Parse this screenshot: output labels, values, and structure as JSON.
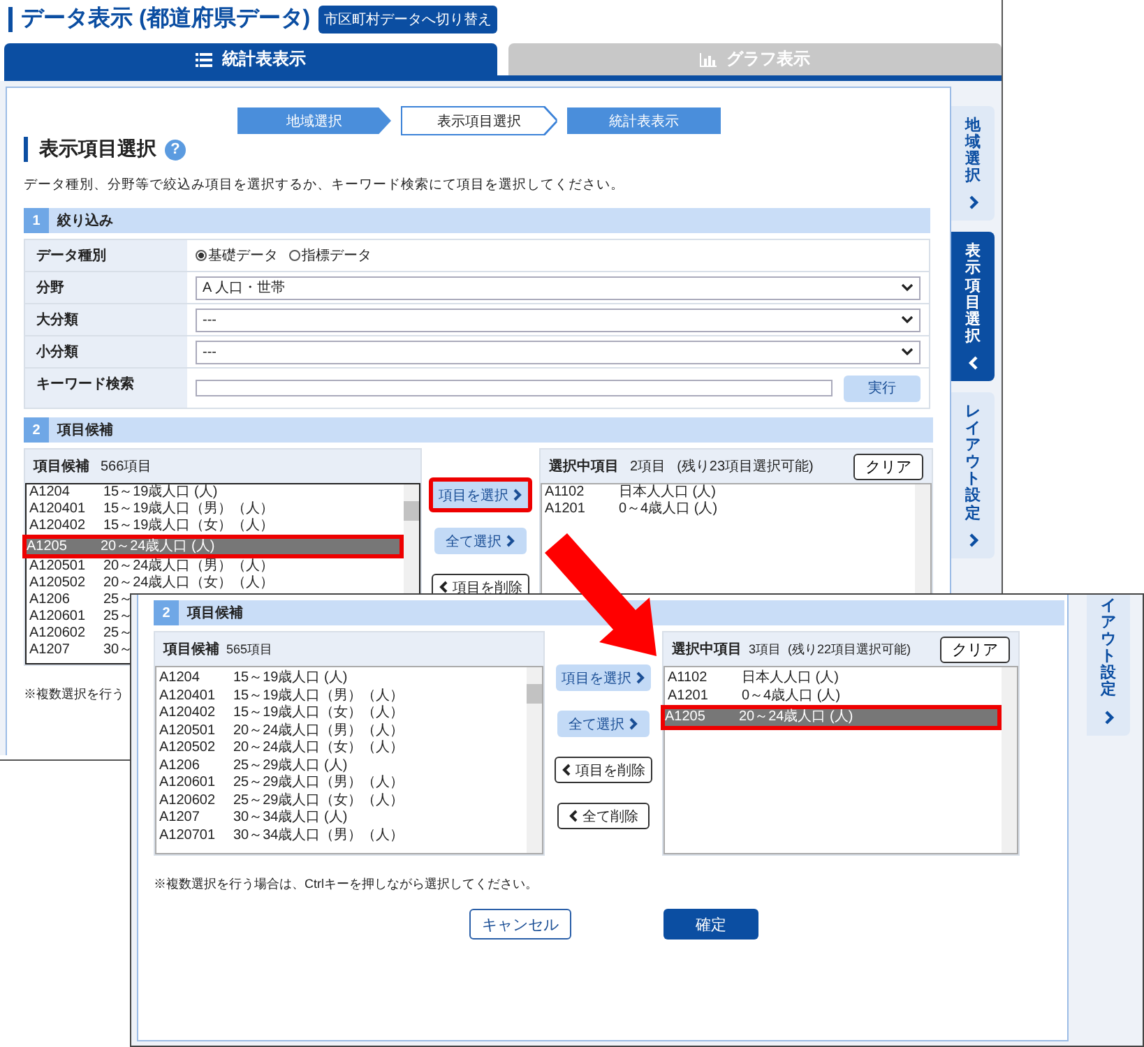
{
  "page_title": "データ表示 (都道府県データ)",
  "switch_button": "市区町村データへ切り替え",
  "view_tabs": [
    {
      "label": "統計表表示",
      "kind": "table",
      "selected": true
    },
    {
      "label": "グラフ表示",
      "kind": "graph",
      "selected": false
    }
  ],
  "steps": [
    {
      "label": "地域選択",
      "current": false
    },
    {
      "label": "表示項目選択",
      "current": true
    },
    {
      "label": "統計表表示",
      "current": false
    }
  ],
  "heading": "表示項目選択",
  "help_label": "?",
  "description": "データ種別、分野等で絞込み項目を選択するか、キーワード検索にて項目を選択してください。",
  "filter": {
    "number": "1",
    "title": "絞り込み",
    "rows": [
      {
        "kind": "radio",
        "label": "データ種別",
        "options": [
          {
            "label": "基礎データ",
            "selected": true
          },
          {
            "label": "指標データ",
            "selected": false
          }
        ]
      },
      {
        "kind": "select",
        "label": "分野",
        "value": "A 人口・世帯"
      },
      {
        "kind": "select",
        "label": "大分類",
        "value": "---"
      },
      {
        "kind": "select",
        "label": "小分類",
        "value": "---"
      },
      {
        "kind": "keyword",
        "label": "キーワード検索",
        "button": "実行"
      }
    ]
  },
  "candidates": {
    "number": "2",
    "title": "項目候補",
    "left": {
      "title": "項目候補",
      "count": "566項目",
      "rows": [
        {
          "code": "A1204",
          "name": "15～19歳人口 (人)",
          "selected": false,
          "highlighted": false
        },
        {
          "code": "A120401",
          "name": "15～19歳人口（男）（人）",
          "selected": false,
          "highlighted": false
        },
        {
          "code": "A120402",
          "name": "15～19歳人口（女）（人）",
          "selected": false,
          "highlighted": false
        },
        {
          "code": "A1205",
          "name": "20～24歳人口 (人)",
          "selected": true,
          "highlighted": true
        },
        {
          "code": "A120501",
          "name": "20～24歳人口（男）（人）",
          "selected": false,
          "highlighted": false
        },
        {
          "code": "A120502",
          "name": "20～24歳人口（女）（人）",
          "selected": false,
          "highlighted": false
        },
        {
          "code": "A1206",
          "name": "25～",
          "selected": false,
          "highlighted": false
        },
        {
          "code": "A120601",
          "name": "25～",
          "selected": false,
          "highlighted": false
        },
        {
          "code": "A120602",
          "name": "25～",
          "selected": false,
          "highlighted": false
        },
        {
          "code": "A1207",
          "name": "30～",
          "selected": false,
          "highlighted": false
        }
      ]
    },
    "actions": [
      {
        "label": "項目を選択",
        "kind": "add",
        "highlighted": true
      },
      {
        "label": "全て選択",
        "kind": "add",
        "highlighted": false
      },
      {
        "label": "項目を削除",
        "kind": "remove",
        "highlighted": false
      }
    ],
    "right": {
      "title": "選択中項目",
      "count": "2項目",
      "note": "(残り23項目選択可能)",
      "clear": "クリア",
      "rows": [
        {
          "code": "A1102",
          "name": "日本人人口 (人)",
          "selected": false,
          "highlighted": false
        },
        {
          "code": "A1201",
          "name": "0～4歳人口 (人)",
          "selected": false,
          "highlighted": false
        }
      ]
    },
    "note": "※複数選択を行う"
  },
  "side_tabs": [
    {
      "label": "地域選択",
      "selected": false
    },
    {
      "label": "表示項目選択",
      "selected": true
    },
    {
      "label": "レイアウト設定",
      "selected": false
    }
  ],
  "overlay": {
    "candidates": {
      "number": "2",
      "title": "項目候補",
      "left": {
        "title": "項目候補",
        "count": "565項目",
        "rows": [
          {
            "code": "A1204",
            "name": "15～19歳人口 (人)",
            "selected": false,
            "highlighted": false
          },
          {
            "code": "A120401",
            "name": "15～19歳人口（男）（人）",
            "selected": false,
            "highlighted": false
          },
          {
            "code": "A120402",
            "name": "15～19歳人口（女）（人）",
            "selected": false,
            "highlighted": false
          },
          {
            "code": "A120501",
            "name": "20～24歳人口（男）（人）",
            "selected": false,
            "highlighted": false
          },
          {
            "code": "A120502",
            "name": "20～24歳人口（女）（人）",
            "selected": false,
            "highlighted": false
          },
          {
            "code": "A1206",
            "name": "25～29歳人口 (人)",
            "selected": false,
            "highlighted": false
          },
          {
            "code": "A120601",
            "name": "25～29歳人口（男）（人）",
            "selected": false,
            "highlighted": false
          },
          {
            "code": "A120602",
            "name": "25～29歳人口（女）（人）",
            "selected": false,
            "highlighted": false
          },
          {
            "code": "A1207",
            "name": "30～34歳人口 (人)",
            "selected": false,
            "highlighted": false
          },
          {
            "code": "A120701",
            "name": "30～34歳人口（男）（人）",
            "selected": false,
            "highlighted": false
          }
        ]
      },
      "actions": [
        {
          "label": "項目を選択",
          "kind": "add",
          "highlighted": false
        },
        {
          "label": "全て選択",
          "kind": "add",
          "highlighted": false
        },
        {
          "label": "項目を削除",
          "kind": "remove",
          "highlighted": false
        },
        {
          "label": "全て削除",
          "kind": "remove",
          "highlighted": false
        }
      ],
      "right": {
        "title": "選択中項目",
        "count": "3項目",
        "note": "(残り22項目選択可能)",
        "clear": "クリア",
        "rows": [
          {
            "code": "A1102",
            "name": "日本人人口 (人)",
            "selected": false,
            "highlighted": false
          },
          {
            "code": "A1201",
            "name": "0～4歳人口 (人)",
            "selected": false,
            "highlighted": false
          },
          {
            "code": "A1205",
            "name": "20～24歳人口 (人)",
            "selected": true,
            "highlighted": true
          }
        ]
      },
      "note": "※複数選択を行う場合は、Ctrlキーを押しながら選択してください。"
    },
    "footer_buttons": [
      {
        "label": "キャンセル",
        "kind": "outline"
      },
      {
        "label": "確定",
        "kind": "primary"
      }
    ],
    "side_tab": "イアウト設定"
  }
}
